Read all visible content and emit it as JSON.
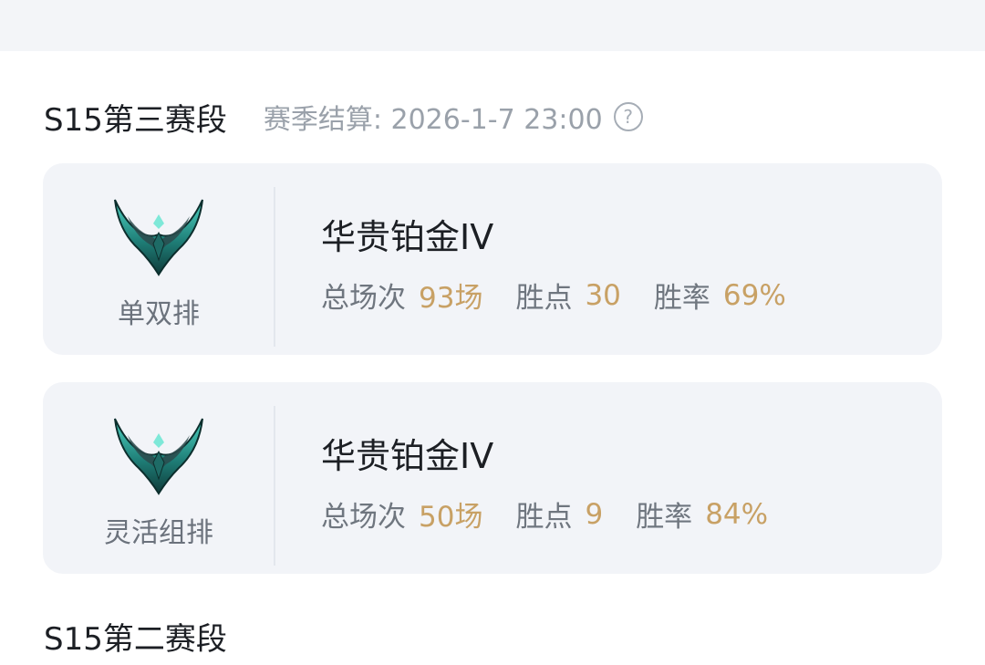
{
  "seasons": [
    {
      "title": "S15第三赛段",
      "settlement": "赛季结算: 2026-1-7 23:00",
      "help_glyph": "?",
      "help_icon": "question-circle-icon",
      "rank_cards": [
        {
          "queue": "单双排",
          "tier": "华贵铂金IV",
          "emblem_icon": "platinum-emblem-icon",
          "stats": [
            {
              "label": "总场次",
              "value": "93场"
            },
            {
              "label": "胜点",
              "value": "30"
            },
            {
              "label": "胜率",
              "value": "69%"
            }
          ]
        },
        {
          "queue": "灵活组排",
          "tier": "华贵铂金IV",
          "emblem_icon": "platinum-emblem-icon",
          "stats": [
            {
              "label": "总场次",
              "value": "50场"
            },
            {
              "label": "胜点",
              "value": "9"
            },
            {
              "label": "胜率",
              "value": "84%"
            }
          ]
        }
      ]
    },
    {
      "title": "S15第二赛段"
    }
  ],
  "colors": {
    "page_background": "#ffffff",
    "top_band": "#f3f5f8",
    "card_background": "#f2f4f8",
    "stat_value": "#c8a165",
    "emblem_teal": "#2a9f93"
  }
}
